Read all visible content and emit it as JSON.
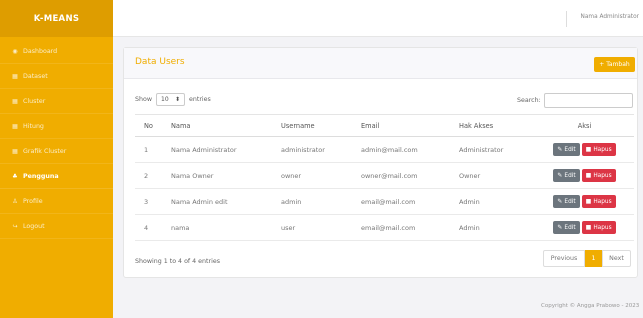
{
  "brand": "K-MEANS",
  "menu": [
    {
      "icon": "dashboard-icon",
      "glyph": "◉",
      "label": "Dashboard",
      "active": false
    },
    {
      "icon": "table-icon",
      "glyph": "▦",
      "label": "Dataset",
      "active": false
    },
    {
      "icon": "table-icon",
      "glyph": "▦",
      "label": "Cluster",
      "active": false
    },
    {
      "icon": "table-icon",
      "glyph": "▦",
      "label": "Hitung",
      "active": false
    },
    {
      "icon": "table-icon",
      "glyph": "▦",
      "label": "Grafik Cluster",
      "active": false
    },
    {
      "icon": "users-icon",
      "glyph": "♣",
      "label": "Pengguna",
      "active": true
    },
    {
      "icon": "user-icon",
      "glyph": "♙",
      "label": "Profile",
      "active": false
    },
    {
      "icon": "logout-icon",
      "glyph": "↪",
      "label": "Logout",
      "active": false
    }
  ],
  "topbar": {
    "user_name": "Nama Administrator"
  },
  "card": {
    "title": "Data Users",
    "add_button": "+ Tambah"
  },
  "controls": {
    "show_label": "Show",
    "entries_value": "10",
    "entries_label": "entries",
    "search_label": "Search:"
  },
  "table": {
    "headers": [
      "No",
      "Nama",
      "Username",
      "Email",
      "Hak Akses",
      "Aksi"
    ],
    "rows": [
      [
        "1",
        "Nama Administrator",
        "administrator",
        "admin@mail.com",
        "Administrator"
      ],
      [
        "2",
        "Nama Owner",
        "owner",
        "owner@mail.com",
        "Owner"
      ],
      [
        "3",
        "Nama Admin edit",
        "admin",
        "email@mail.com",
        "Admin"
      ],
      [
        "4",
        "nama",
        "user",
        "email@mail.com",
        "Admin"
      ]
    ],
    "edit_label": "Edit",
    "delete_label": "Hapus"
  },
  "info": "Showing 1 to 4 of 4 entries",
  "pagination": {
    "previous": "Previous",
    "current": "1",
    "next": "Next"
  },
  "footer": "Copyright © Angga Prabowo - 2023"
}
